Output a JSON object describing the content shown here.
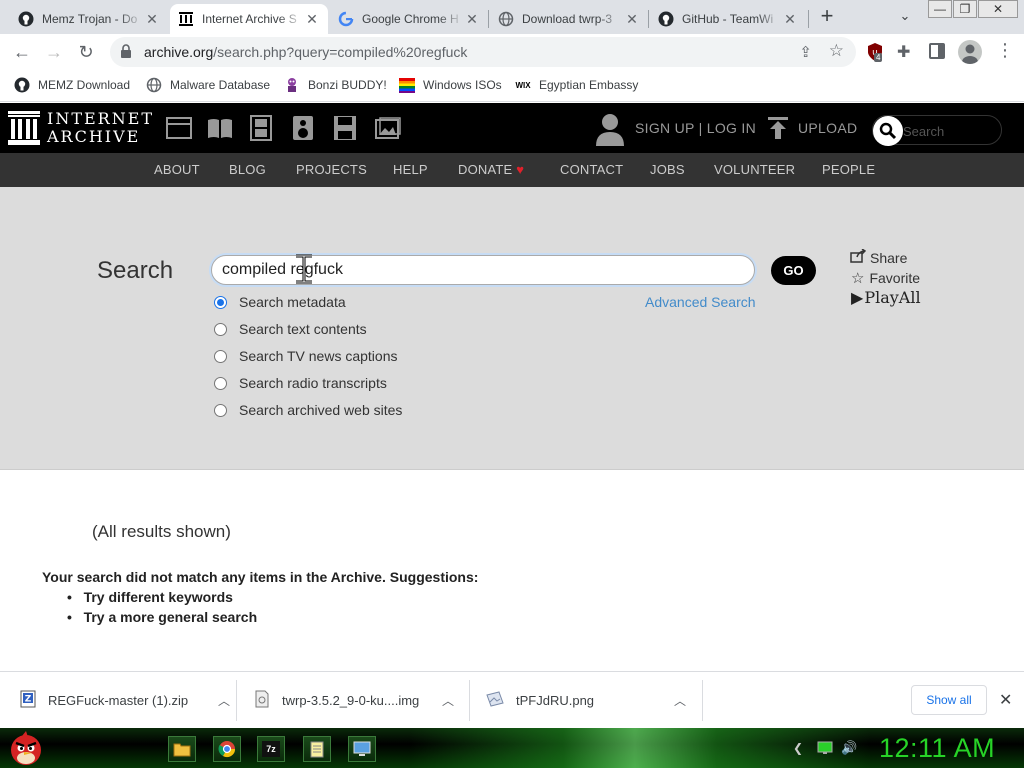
{
  "browser": {
    "tabs": [
      {
        "title": "Memz Trojan - Do",
        "icon": "github-icon"
      },
      {
        "title": "Internet Archive S",
        "icon": "archive-icon"
      },
      {
        "title": "Google Chrome H",
        "icon": "google-icon"
      },
      {
        "title": "Download twrp-3",
        "icon": "globe-icon"
      },
      {
        "title": "GitHub - TeamWi",
        "icon": "github-icon"
      }
    ],
    "new_tab": "+",
    "url_domain": "archive.org",
    "url_path": "/search.php?query=compiled%20regfuck",
    "extension_badge": "4"
  },
  "bookmarks": [
    {
      "label": "MEMZ Download",
      "icon": "github-icon"
    },
    {
      "label": "Malware Database",
      "icon": "globe-icon"
    },
    {
      "label": "Bonzi BUDDY!",
      "icon": "bonzi-icon"
    },
    {
      "label": "Windows ISOs",
      "icon": "windows-flag-icon"
    },
    {
      "label": "Egyptian Embassy",
      "icon": "wix-icon"
    }
  ],
  "ia": {
    "logo_line1": "INTERNET",
    "logo_line2": "ARCHIVE",
    "signup_login": "SIGN UP | LOG IN",
    "upload": "UPLOAD",
    "search_placeholder": "Search",
    "nav": [
      "ABOUT",
      "BLOG",
      "PROJECTS",
      "HELP",
      "DONATE",
      "CONTACT",
      "JOBS",
      "VOLUNTEER",
      "PEOPLE"
    ]
  },
  "search": {
    "heading": "Search",
    "query": "compiled regfuck",
    "go": "GO",
    "advanced": "Advanced Search",
    "options": [
      {
        "label": "Search metadata",
        "checked": true
      },
      {
        "label": "Search text contents",
        "checked": false
      },
      {
        "label": "Search TV news captions",
        "checked": false
      },
      {
        "label": "Search radio transcripts",
        "checked": false
      },
      {
        "label": "Search archived web sites",
        "checked": false
      }
    ],
    "share": "Share",
    "favorite": "Favorite",
    "playall": "PlayAll"
  },
  "results": {
    "all_shown": "(All results shown)",
    "no_match": "Your search did not match any items in the Archive. Suggestions:",
    "suggestions": [
      "Try different keywords",
      "Try a more general search"
    ]
  },
  "downloads": {
    "items": [
      {
        "name": "REGFuck-master (1).zip",
        "icon": "zip-file-icon"
      },
      {
        "name": "twrp-3.5.2_9-0-ku....img",
        "icon": "disk-image-icon"
      },
      {
        "name": "tPFJdRU.png",
        "icon": "image-file-icon"
      }
    ],
    "show_all": "Show all"
  },
  "taskbar": {
    "clock": "12:11 AM"
  },
  "colors": {
    "ia_black": "#000000",
    "ia_subnav": "#333333",
    "search_bg": "#dcdcdc",
    "link_blue": "#428bca",
    "donate_heart": "#e0212b",
    "clock_green": "#27d327"
  }
}
